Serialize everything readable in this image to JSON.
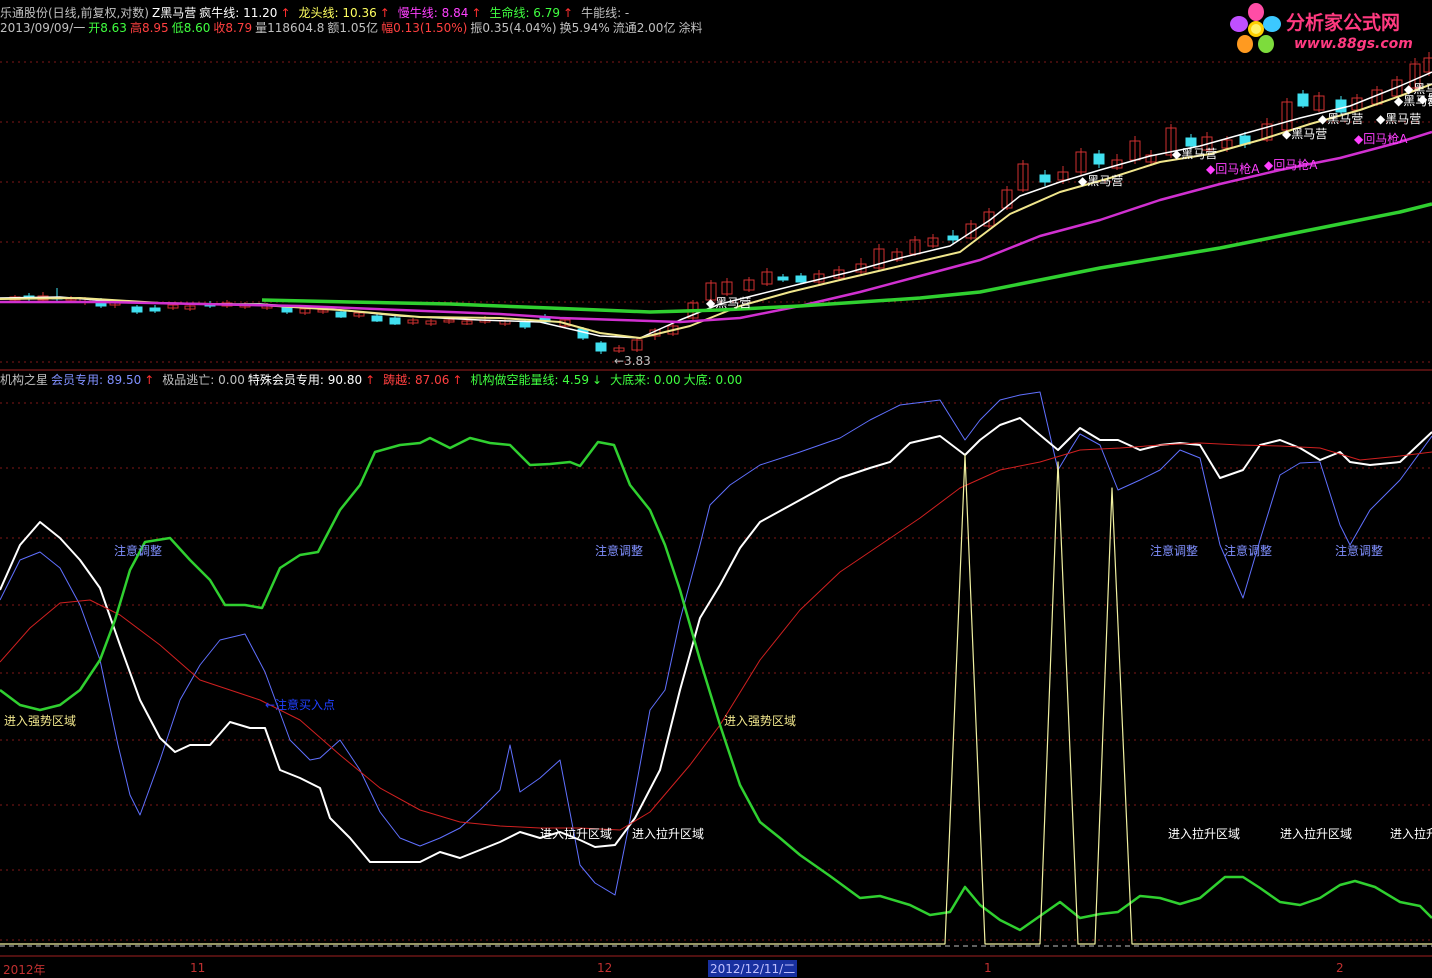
{
  "header": {
    "row1": [
      {
        "text": "乐通股份(日线,前复权,对数)",
        "color": "#c0c0c0"
      },
      {
        "text": "Z黑马营",
        "color": "#ffffff"
      },
      {
        "text": "疯牛线: 11.20",
        "color": "#ffffff"
      },
      {
        "text": "↑",
        "color": "#ff3030"
      },
      {
        "text": "龙头线: 10.36",
        "color": "#ffff60"
      },
      {
        "text": "↑",
        "color": "#ff3030"
      },
      {
        "text": "慢牛线: 8.84",
        "color": "#ff40ff"
      },
      {
        "text": "↑",
        "color": "#ff3030"
      },
      {
        "text": "生命线: 6.79",
        "color": "#40ff40"
      },
      {
        "text": "↑",
        "color": "#ff3030"
      },
      {
        "text": "牛能线: -",
        "color": "#c0c0c0"
      }
    ],
    "row2": [
      {
        "text": "2013/09/09/一",
        "color": "#c0c0c0"
      },
      {
        "text": "开8.63",
        "color": "#40ff40"
      },
      {
        "text": "高8.95",
        "color": "#ff4040"
      },
      {
        "text": "低8.60",
        "color": "#40ff40"
      },
      {
        "text": "收8.79",
        "color": "#ff4040"
      },
      {
        "text": "量118604.8",
        "color": "#c0c0c0"
      },
      {
        "text": "额1.05亿",
        "color": "#c0c0c0"
      },
      {
        "text": "幅0.13(1.50%)",
        "color": "#ff4040"
      },
      {
        "text": "振0.35(4.04%)",
        "color": "#c0c0c0"
      },
      {
        "text": "换5.94%",
        "color": "#c0c0c0"
      },
      {
        "text": "流通2.00亿",
        "color": "#c0c0c0"
      },
      {
        "text": "涂料",
        "color": "#c0c0c0"
      }
    ]
  },
  "watermark": {
    "title": "分析家公式网",
    "url": "www.88gs.com"
  },
  "price_pane": {
    "low_marker": "←3.83",
    "signals": [
      "黑马营",
      "黑马营",
      "黑马营",
      "黑马营",
      "黑马营",
      "黑马营",
      "黑马营",
      "黑马营",
      "黑马营"
    ],
    "signals_b": [
      "回马枪A",
      "回马枪A",
      "回马枪A"
    ]
  },
  "indicator_header": [
    {
      "text": "机构之星",
      "color": "#c0c0c0"
    },
    {
      "text": "会员专用: 89.50",
      "color": "#8090ff"
    },
    {
      "text": "↑",
      "color": "#ff3030"
    },
    {
      "text": "极品逃亡: 0.00",
      "color": "#c0c0c0"
    },
    {
      "text": "特殊会员专用: 90.80",
      "color": "#ffffff"
    },
    {
      "text": "↑",
      "color": "#ff3030"
    },
    {
      "text": "踌越: 87.06",
      "color": "#ff4040"
    },
    {
      "text": "↑",
      "color": "#ff3030"
    },
    {
      "text": "机构做空能量线: 4.59",
      "color": "#40ff40"
    },
    {
      "text": "↓",
      "color": "#40ff40"
    },
    {
      "text": "大底来: 0.00",
      "color": "#40ff40"
    },
    {
      "text": "大底: 0.00",
      "color": "#40ff40"
    }
  ],
  "indicator_labels": {
    "caution": "注意调整",
    "strong": "进入强势区域",
    "lift": "进入拉升区域",
    "buy": "←注意买入点"
  },
  "xaxis": {
    "labels": [
      "2012年",
      "11",
      "12",
      "2012/12/11/二",
      "1",
      "2"
    ]
  },
  "colors": {
    "bg": "#000000",
    "up": "#d03030",
    "down": "#40e0f0",
    "white_line": "#ffffff",
    "yellow_line": "#f0e68c",
    "magenta_line": "#d030d0",
    "green_line": "#30d030",
    "blue_line": "#6070ff",
    "red_line": "#d02020",
    "grid": "#801818"
  }
}
